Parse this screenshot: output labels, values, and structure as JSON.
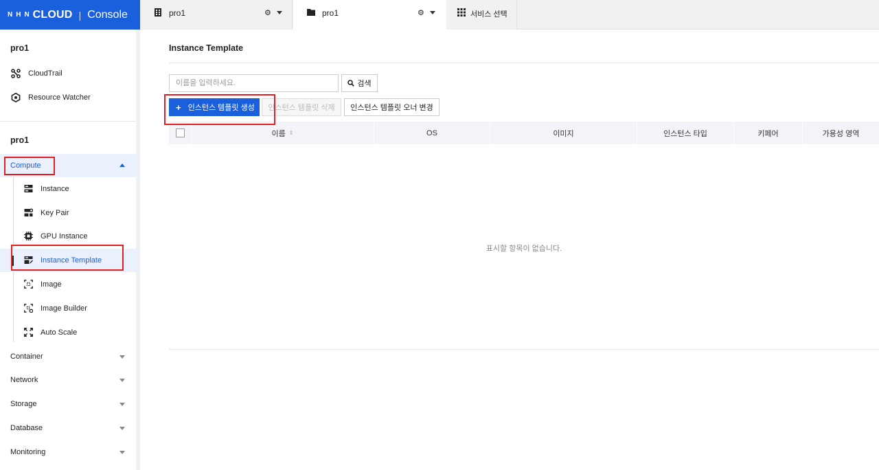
{
  "logo": {
    "brand_prefix": "NHN",
    "brand": "CLOUD",
    "separator": "|",
    "product": "Console"
  },
  "top_tabs": {
    "org": {
      "label": "pro1",
      "icon": "building-icon"
    },
    "project": {
      "label": "pro1",
      "icon": "folder-icon"
    },
    "service": {
      "label": "서비스 선택",
      "icon": "grid-icon"
    }
  },
  "sidebar": {
    "org_title": "pro1",
    "org_items": [
      {
        "label": "CloudTrail",
        "icon": "cloudtrail-icon"
      },
      {
        "label": "Resource Watcher",
        "icon": "resource-watcher-icon"
      }
    ],
    "project_title": "pro1",
    "compute": {
      "label": "Compute",
      "children": [
        {
          "label": "Instance",
          "icon": "instance-icon"
        },
        {
          "label": "Key Pair",
          "icon": "key-pair-icon"
        },
        {
          "label": "GPU Instance",
          "icon": "gpu-icon"
        },
        {
          "label": "Instance Template",
          "icon": "instance-template-icon",
          "active": true
        },
        {
          "label": "Image",
          "icon": "image-icon"
        },
        {
          "label": "Image Builder",
          "icon": "image-builder-icon"
        },
        {
          "label": "Auto Scale",
          "icon": "auto-scale-icon"
        }
      ]
    },
    "groups": [
      "Container",
      "Network",
      "Storage",
      "Database",
      "Monitoring"
    ]
  },
  "main": {
    "title": "Instance Template",
    "search": {
      "placeholder": "이름을 입력하세요.",
      "button_label": "검색"
    },
    "buttons": {
      "create": "인스턴스 템플릿 생성",
      "delete": "인스턴스 템플릿 삭제",
      "change_owner": "인스턴스 템플릿 오너 변경"
    },
    "table": {
      "columns": [
        "이름",
        "OS",
        "이미지",
        "인스턴스 타입",
        "키페어",
        "가용성 영역"
      ],
      "rows": [],
      "empty_text": "표시할 항목이 없습니다."
    }
  },
  "colors": {
    "brand_blue": "#1a5fdc",
    "highlight_red": "#e02020",
    "active_bg": "#eaf1fd"
  }
}
